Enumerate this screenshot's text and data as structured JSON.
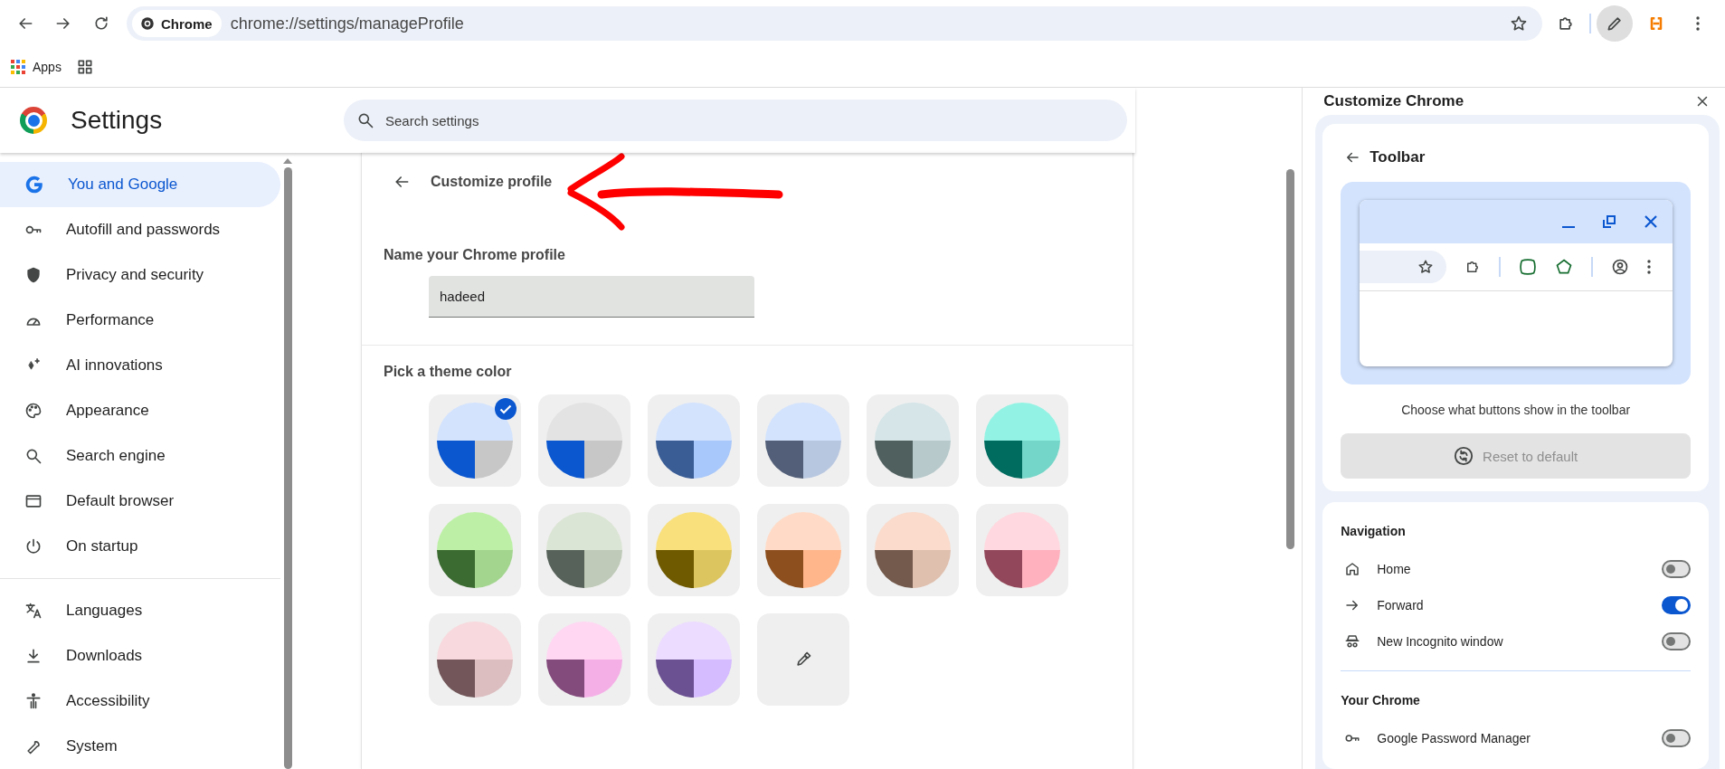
{
  "browser_toolbar": {
    "site_chip": "Chrome",
    "url": "chrome://settings/manageProfile"
  },
  "bookmarks_bar": {
    "items": [
      {
        "label": "Apps"
      }
    ]
  },
  "settings_header": {
    "title": "Settings",
    "search": {
      "placeholder": "Search settings"
    }
  },
  "sidebar": {
    "sections": [
      {
        "items": [
          {
            "label": "You and Google",
            "selected": true
          },
          {
            "label": "Autofill and passwords",
            "selected": false
          },
          {
            "label": "Privacy and security",
            "selected": false
          },
          {
            "label": "Performance",
            "selected": false
          },
          {
            "label": "AI innovations",
            "selected": false
          },
          {
            "label": "Appearance",
            "selected": false
          },
          {
            "label": "Search engine",
            "selected": false
          },
          {
            "label": "Default browser",
            "selected": false
          },
          {
            "label": "On startup",
            "selected": false
          }
        ]
      },
      {
        "items": [
          {
            "label": "Languages",
            "selected": false
          },
          {
            "label": "Downloads",
            "selected": false
          },
          {
            "label": "Accessibility",
            "selected": false
          },
          {
            "label": "System",
            "selected": false
          }
        ]
      }
    ]
  },
  "main": {
    "header": {
      "title": "Customize profile"
    },
    "name_section": {
      "label": "Name your Chrome profile",
      "value": "hadeed"
    },
    "theme_section": {
      "label": "Pick a theme color",
      "swatches": [
        {
          "kind": "preset",
          "colors": [
            {
              "color": "#d3e3fd"
            },
            {
              "color": "#0b57d0"
            },
            {
              "color": "#c7c7c7"
            }
          ],
          "selected": true
        },
        {
          "kind": "preset",
          "colors": [
            {
              "color": "#e3e3e3"
            },
            {
              "color": "#0b57d0"
            },
            {
              "color": "#c7c7c7"
            }
          ],
          "selected": false
        },
        {
          "kind": "preset",
          "colors": [
            {
              "color": "#d3e3fd"
            },
            {
              "color": "#3a5d96"
            },
            {
              "color": "#a8c7fa"
            }
          ],
          "selected": false
        },
        {
          "kind": "preset",
          "colors": [
            {
              "color": "#d3e3fd"
            },
            {
              "color": "#535f78"
            },
            {
              "color": "#b8c7e0"
            }
          ],
          "selected": false
        },
        {
          "kind": "preset",
          "colors": [
            {
              "color": "#d5e5e8"
            },
            {
              "color": "#50605f"
            },
            {
              "color": "#b7c9cb"
            }
          ],
          "selected": false
        },
        {
          "kind": "preset",
          "colors": [
            {
              "color": "#92f3e4"
            },
            {
              "color": "#006b5f"
            },
            {
              "color": "#74d6c8"
            }
          ],
          "selected": false
        },
        {
          "kind": "preset",
          "colors": [
            {
              "color": "#bdf0a6"
            },
            {
              "color": "#3b6b30"
            },
            {
              "color": "#a3d58f"
            }
          ],
          "selected": false
        },
        {
          "kind": "preset",
          "colors": [
            {
              "color": "#dbe5d5"
            },
            {
              "color": "#57625a"
            },
            {
              "color": "#bfcab8"
            }
          ],
          "selected": false
        },
        {
          "kind": "preset",
          "colors": [
            {
              "color": "#f9e07c"
            },
            {
              "color": "#6f5a00"
            },
            {
              "color": "#dcc55f"
            }
          ],
          "selected": false
        },
        {
          "kind": "preset",
          "colors": [
            {
              "color": "#ffdbc7"
            },
            {
              "color": "#8d4f1e"
            },
            {
              "color": "#ffb68a"
            }
          ],
          "selected": false
        },
        {
          "kind": "preset",
          "colors": [
            {
              "color": "#fadbcc"
            },
            {
              "color": "#735a4c"
            },
            {
              "color": "#dfbfae"
            }
          ],
          "selected": false
        },
        {
          "kind": "preset",
          "colors": [
            {
              "color": "#ffd9df"
            },
            {
              "color": "#92485a"
            },
            {
              "color": "#ffb1be"
            }
          ],
          "selected": false
        },
        {
          "kind": "preset",
          "colors": [
            {
              "color": "#f8d9dd"
            },
            {
              "color": "#725659"
            },
            {
              "color": "#dcbdc0"
            }
          ],
          "selected": false
        },
        {
          "kind": "preset",
          "colors": [
            {
              "color": "#ffd7f3"
            },
            {
              "color": "#834a7c"
            },
            {
              "color": "#f4afe6"
            }
          ],
          "selected": false
        },
        {
          "kind": "preset",
          "colors": [
            {
              "color": "#ecdcff"
            },
            {
              "color": "#6b5192"
            },
            {
              "color": "#d5bbff"
            }
          ],
          "selected": false
        },
        {
          "kind": "custom",
          "selected": false
        }
      ]
    }
  },
  "side_panel": {
    "title": "Customize Chrome",
    "toolbar_card": {
      "title": "Toolbar",
      "caption": "Choose what buttons show in the toolbar",
      "reset_button": {
        "label": "Reset to default",
        "disabled": true
      }
    },
    "sections": [
      {
        "title": "Navigation",
        "items": [
          {
            "label": "Home",
            "on": false
          },
          {
            "label": "Forward",
            "on": true
          },
          {
            "label": "New Incognito window",
            "on": false
          }
        ]
      },
      {
        "title": "Your Chrome",
        "items": [
          {
            "label": "Google Password Manager",
            "on": false
          }
        ]
      }
    ]
  }
}
